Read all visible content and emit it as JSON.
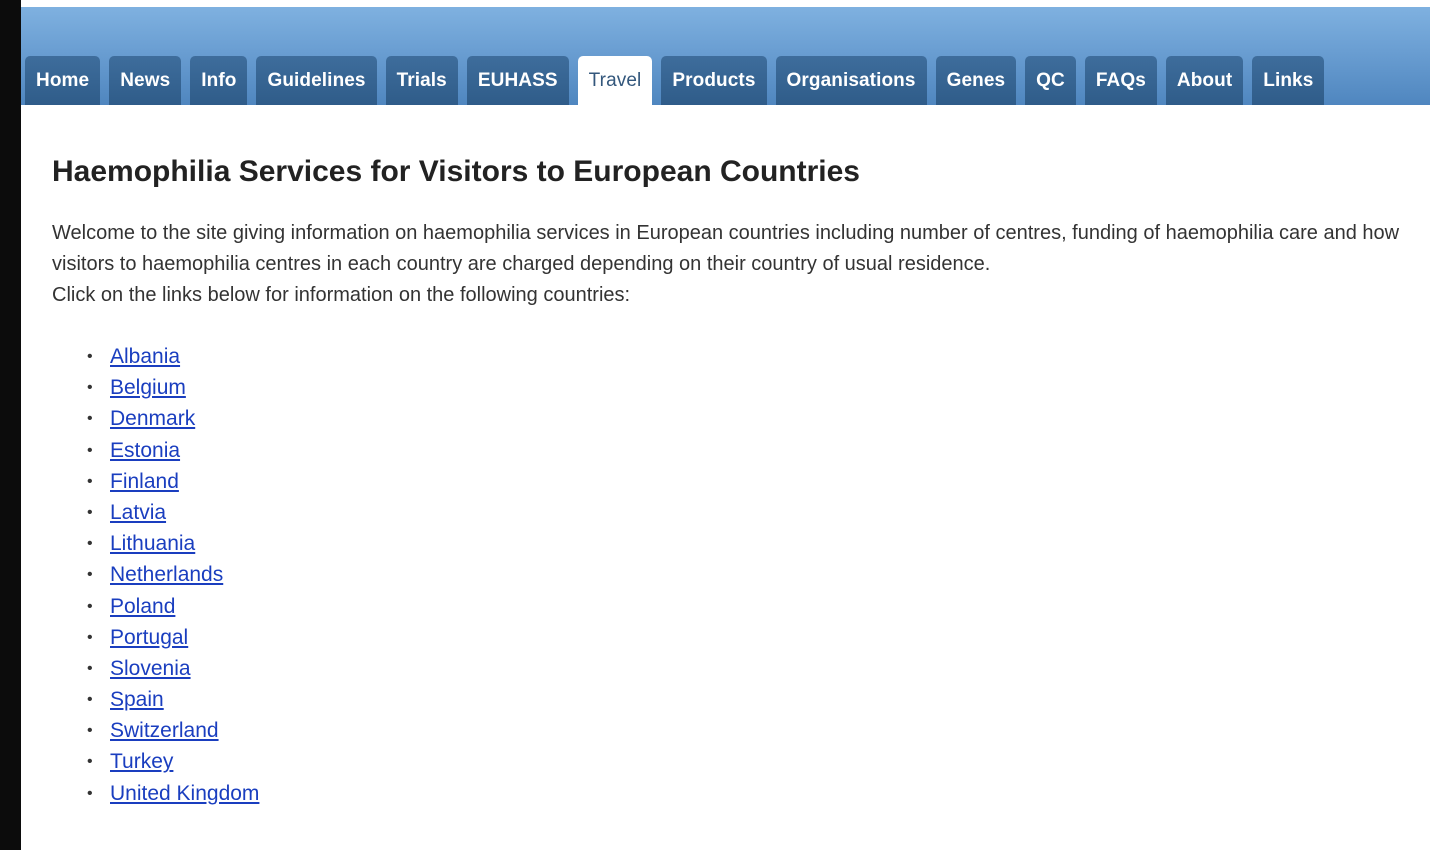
{
  "nav": {
    "tabs": [
      {
        "label": "Home",
        "active": false
      },
      {
        "label": "News",
        "active": false
      },
      {
        "label": "Info",
        "active": false
      },
      {
        "label": "Guidelines",
        "active": false
      },
      {
        "label": "Trials",
        "active": false
      },
      {
        "label": "EUHASS",
        "active": false
      },
      {
        "label": "Travel",
        "active": true
      },
      {
        "label": "Products",
        "active": false
      },
      {
        "label": "Organisations",
        "active": false
      },
      {
        "label": "Genes",
        "active": false
      },
      {
        "label": "QC",
        "active": false
      },
      {
        "label": "FAQs",
        "active": false
      },
      {
        "label": "About",
        "active": false
      },
      {
        "label": "Links",
        "active": false
      }
    ]
  },
  "main": {
    "title": "Haemophilia Services for Visitors to European Countries",
    "intro_line1": "Welcome to the site giving information on haemophilia services in European countries including number of centres, funding of haemophilia care and how visitors to haemophilia centres in each country are charged depending on their country of usual residence.",
    "intro_line2": "Click on the links below for information on the following countries:",
    "countries": [
      "Albania",
      "Belgium",
      "Denmark",
      "Estonia",
      "Finland",
      "Latvia",
      "Lithuania",
      "Netherlands",
      "Poland",
      "Portugal",
      "Slovenia",
      "Spain",
      "Switzerland",
      "Turkey",
      "United Kingdom"
    ]
  },
  "colors": {
    "header_top": "#7fb1e0",
    "tab_bg": "#2f5c89",
    "active_tab_text": "#33577c",
    "link": "#1a3ebf"
  }
}
